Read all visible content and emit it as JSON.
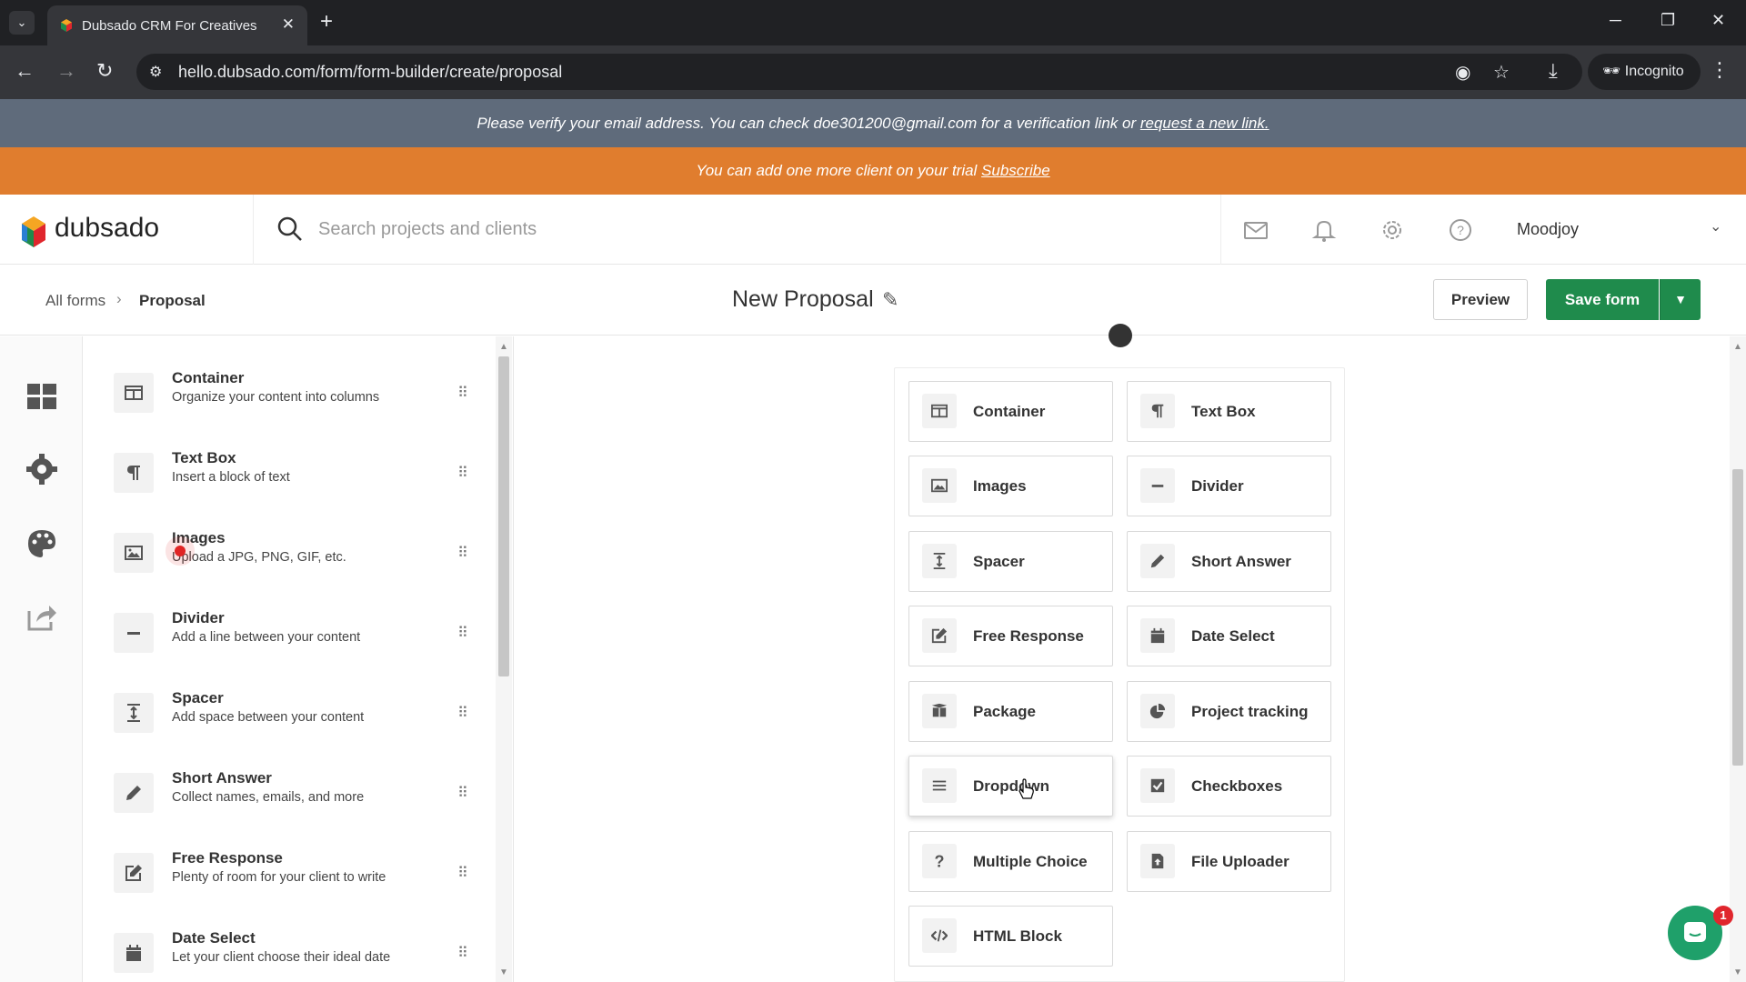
{
  "browser": {
    "tab_title": "Dubsado CRM For Creatives",
    "url": "hello.dubsado.com/form/form-builder/create/proposal",
    "incognito_label": "Incognito"
  },
  "banners": {
    "verify_text": "Please verify your email address. You can check doe301200@gmail.com for a verification link or ",
    "verify_link": "request a new link.",
    "trial_text": "You can add one more client on your trial ",
    "trial_link": "Subscribe"
  },
  "header": {
    "logo_text": "dubsado",
    "search_placeholder": "Search projects and clients",
    "user_name": "Moodjoy"
  },
  "form_header": {
    "crumb_all": "All forms",
    "crumb_sep": "›",
    "crumb_current": "Proposal",
    "title": "New Proposal",
    "preview_label": "Preview",
    "save_label": "Save form"
  },
  "elements_list": [
    {
      "title": "Container",
      "desc": "Organize your content into columns",
      "icon": "container-icon"
    },
    {
      "title": "Text Box",
      "desc": "Insert a block of text",
      "icon": "paragraph-icon"
    },
    {
      "title": "Images",
      "desc": "Upload a JPG, PNG, GIF, etc.",
      "icon": "image-icon"
    },
    {
      "title": "Divider",
      "desc": "Add a line between your content",
      "icon": "divider-icon"
    },
    {
      "title": "Spacer",
      "desc": "Add space between your content",
      "icon": "spacer-icon"
    },
    {
      "title": "Short Answer",
      "desc": "Collect names, emails, and more",
      "icon": "pencil-icon"
    },
    {
      "title": "Free Response",
      "desc": "Plenty of room for your client to write",
      "icon": "edit-icon"
    },
    {
      "title": "Date Select",
      "desc": "Let your client choose their ideal date",
      "icon": "calendar-icon"
    }
  ],
  "palette": [
    {
      "label": "Container",
      "icon": "container-icon"
    },
    {
      "label": "Text Box",
      "icon": "paragraph-icon"
    },
    {
      "label": "Images",
      "icon": "image-icon"
    },
    {
      "label": "Divider",
      "icon": "divider-icon"
    },
    {
      "label": "Spacer",
      "icon": "spacer-icon"
    },
    {
      "label": "Short Answer",
      "icon": "pencil-icon"
    },
    {
      "label": "Free Response",
      "icon": "edit-icon"
    },
    {
      "label": "Date Select",
      "icon": "calendar-icon"
    },
    {
      "label": "Package",
      "icon": "package-icon"
    },
    {
      "label": "Project tracking",
      "icon": "pie-chart-icon"
    },
    {
      "label": "Dropdown",
      "icon": "list-icon"
    },
    {
      "label": "Checkboxes",
      "icon": "checkbox-icon"
    },
    {
      "label": "Multiple Choice",
      "icon": "question-icon"
    },
    {
      "label": "File Uploader",
      "icon": "file-upload-icon"
    },
    {
      "label": "HTML Block",
      "icon": "code-icon"
    }
  ],
  "chat_badge": "1",
  "colors": {
    "brand_green": "#1f8b4c",
    "trial_orange": "#e07d2e",
    "verify_gray": "#5f6b7b"
  }
}
